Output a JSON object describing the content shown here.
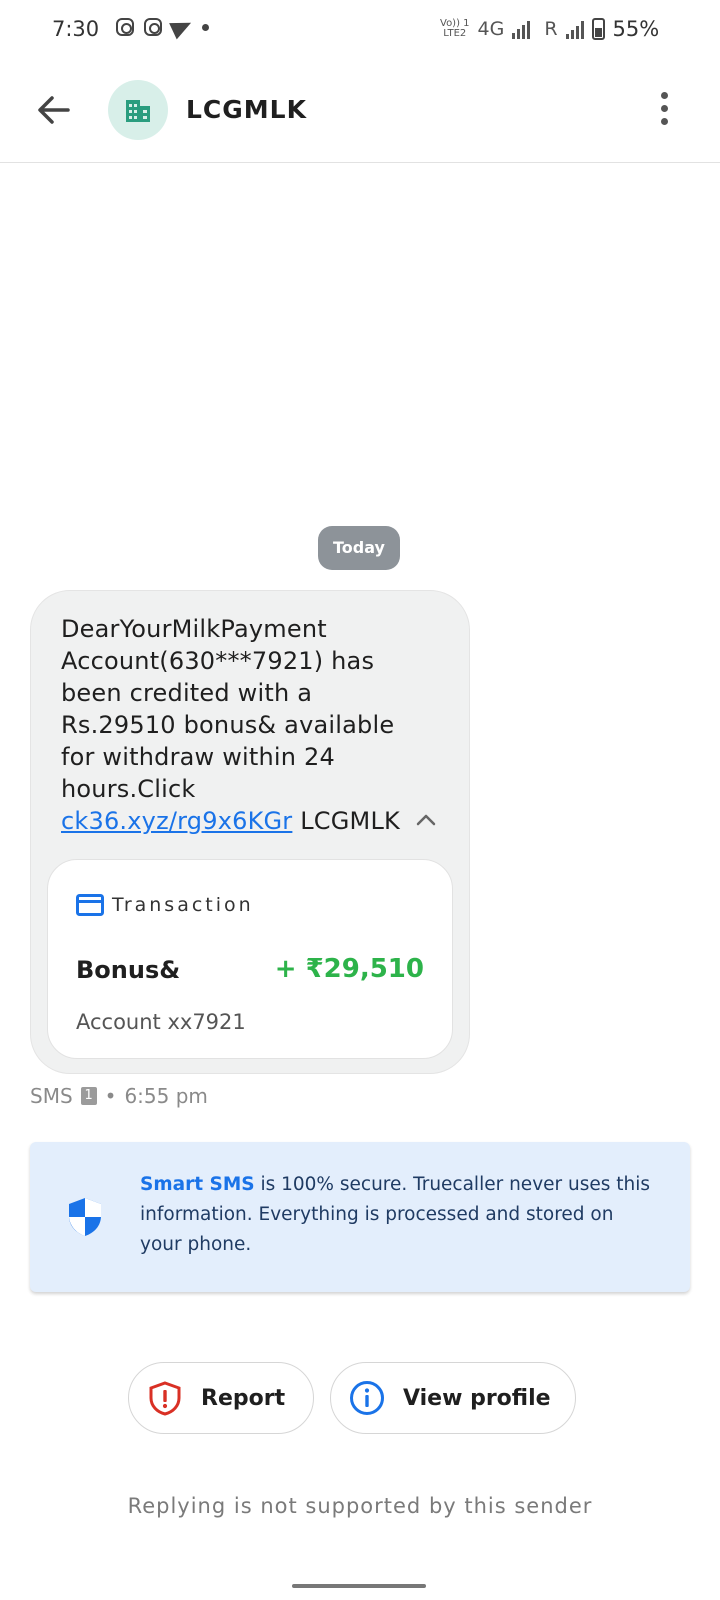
{
  "status_bar": {
    "time": "7:30",
    "network": "4G",
    "roaming": "R",
    "volte_top": "Vo)) 1",
    "volte_bottom": "LTE2",
    "battery": "55%"
  },
  "header": {
    "sender_name": "LCGMLK",
    "avatar_icon": "building-icon",
    "back_icon": "arrow-back-icon",
    "menu_icon": "more-vert-icon"
  },
  "conversation": {
    "date_chip": "Today",
    "message": {
      "text_before_link": "DearYourMilkPayment Account(630***7921) has been credited with a Rs.29510 bonus& available for withdraw within 24 hours.Click ",
      "link_text": "ck36.xyz/rg9x6KGr",
      "text_after_link": " LCGMLK"
    },
    "transaction_card": {
      "title": "Transaction",
      "label": "Bonus&",
      "amount": "+ ₹29,510",
      "account": "Account xx7921",
      "amount_color": "#2db34a"
    },
    "meta": {
      "channel": "SMS",
      "sim": "1",
      "separator": "•",
      "time": "6:55 pm"
    }
  },
  "info_banner": {
    "strong": "Smart SMS",
    "text": " is 100% secure. Truecaller never uses this information. Everything is processed and stored on your phone.",
    "icon": "shield-icon"
  },
  "actions": {
    "report_label": "Report",
    "view_profile_label": "View profile"
  },
  "footer": {
    "reply_note": "Replying is not supported by this sender"
  },
  "colors": {
    "accent": "#1a73e8",
    "report_red": "#d93025",
    "banner_bg": "#e3eefc"
  }
}
